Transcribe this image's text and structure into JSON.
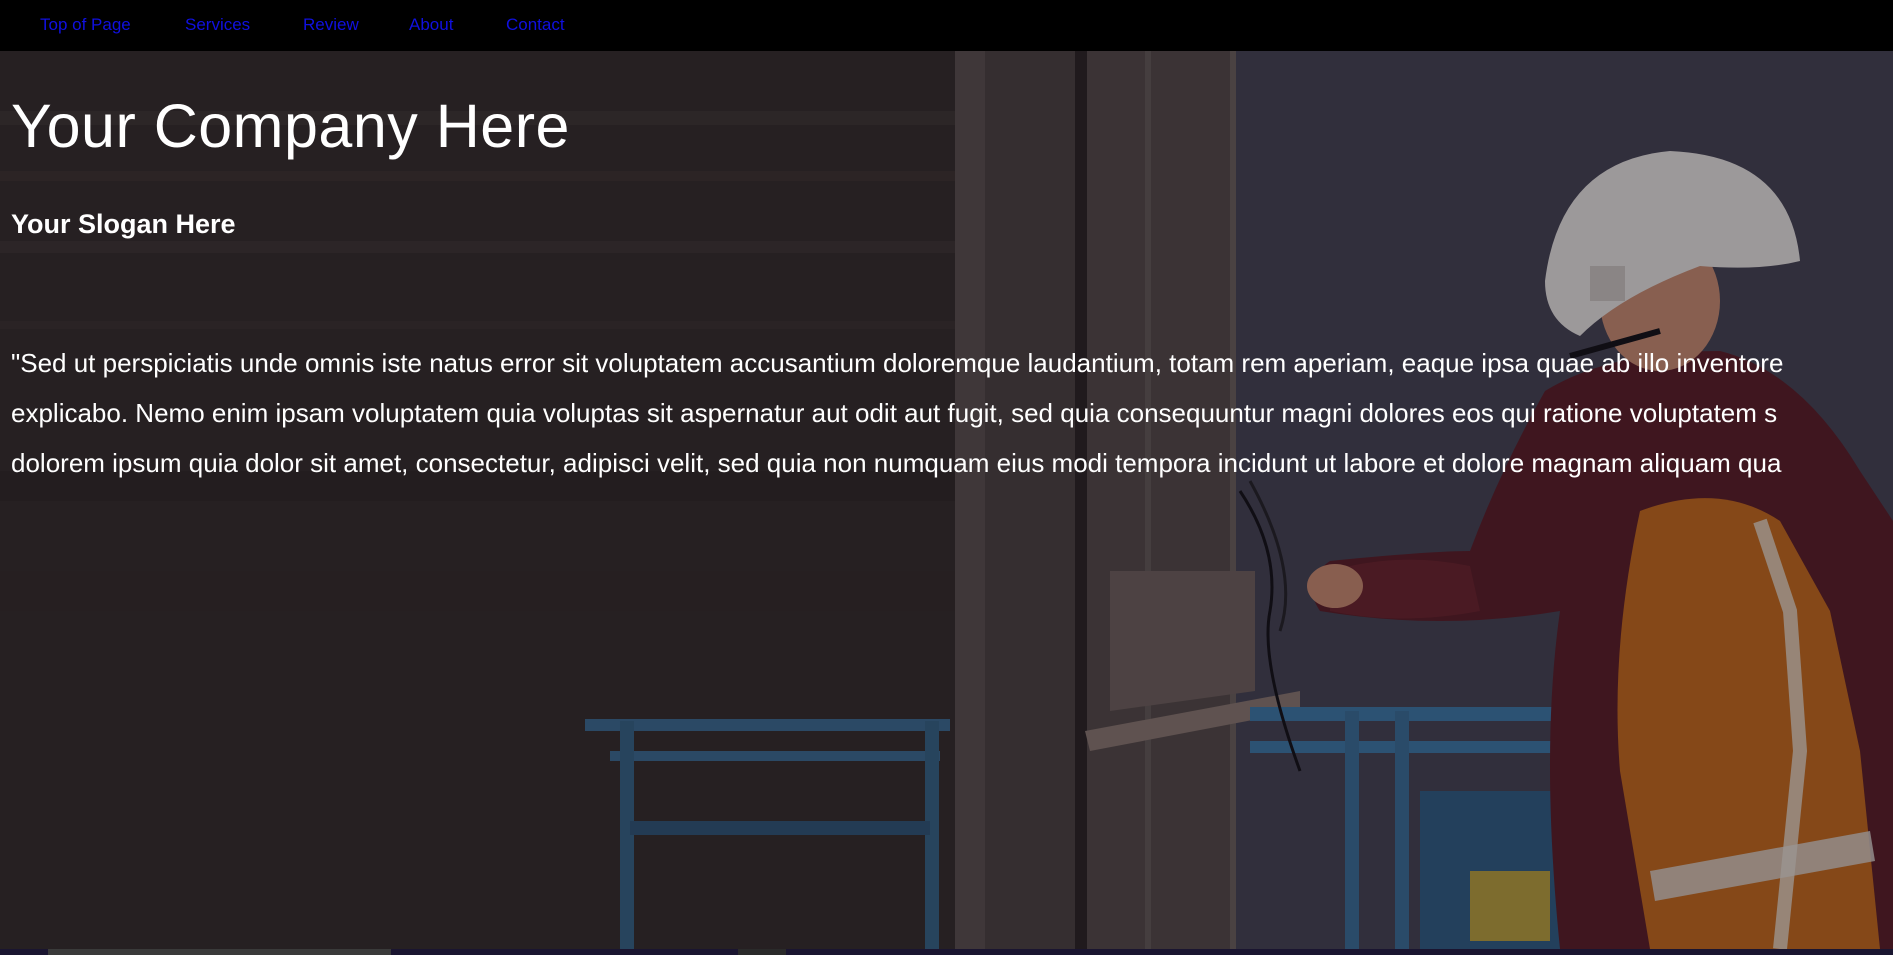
{
  "nav": {
    "items": [
      {
        "label": "Top of Page"
      },
      {
        "label": "Services"
      },
      {
        "label": "Review"
      },
      {
        "label": "About"
      },
      {
        "label": "Contact"
      }
    ],
    "link_color": "#1010e0",
    "background": "#000000"
  },
  "hero": {
    "company": "Your Company Here",
    "slogan": "Your Slogan Here",
    "quote_lines": [
      "\"Sed ut perspiciatis unde omnis iste natus error sit voluptatem accusantium doloremque laudantium, totam rem aperiam, eaque ipsa quae ab illo inventore",
      "explicabo. Nemo enim ipsam voluptatem quia voluptas sit aspernatur aut odit aut fugit, sed quia consequuntur magni dolores eos qui ratione voluptatem s",
      "dolorem ipsum quia dolor sit amet, consectetur, adipisci velit, sed quia non numquam eius modi tempora incidunt ut labore et dolore magnam aliquam qua"
    ],
    "text_color": "#ffffff",
    "background_image": "construction worker with hard hat and high-visibility vest on blue lift"
  }
}
